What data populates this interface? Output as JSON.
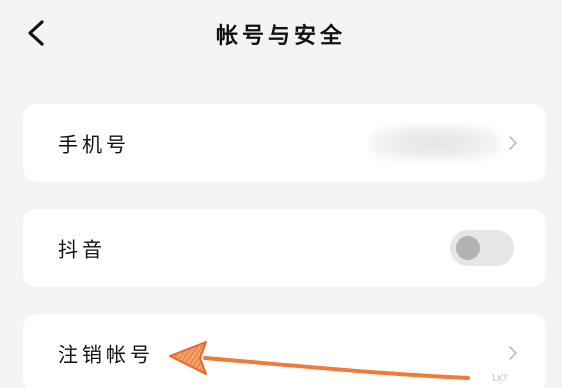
{
  "header": {
    "title": "帐号与安全",
    "back_icon": "chevron-left-icon"
  },
  "settings": [
    {
      "label": "手机号",
      "value_blurred": true,
      "icon": "chevron-right-icon"
    },
    {
      "label": "抖音",
      "toggle_on": false
    },
    {
      "label": "注销帐号",
      "icon": "chevron-right-icon"
    }
  ],
  "annotation": {
    "arrow_color": "#f07a3a",
    "points_to": "注销帐号"
  },
  "watermark": "LKT"
}
